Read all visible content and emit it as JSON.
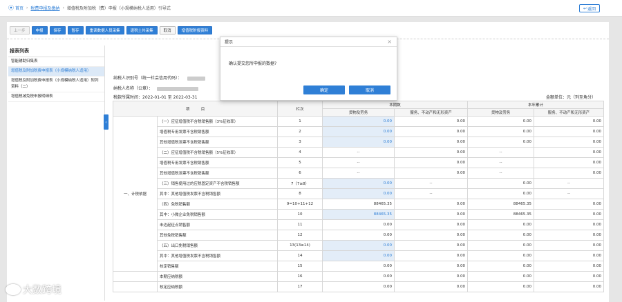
{
  "breadcrumb": {
    "home": "首页",
    "section": "税费申报及缴纳",
    "current": "增值税及附加税（费）申报（小规模纳税人适用）引导式"
  },
  "back_label": "返回",
  "toolbar": [
    {
      "label": "上一步",
      "state": "disabled"
    },
    {
      "label": "申报",
      "state": "primary"
    },
    {
      "label": "保存",
      "state": "primary"
    },
    {
      "label": "暂存",
      "state": "primary"
    },
    {
      "label": "重读数据人员采集",
      "state": "primary"
    },
    {
      "label": "退税土共采集",
      "state": "primary"
    },
    {
      "label": "取消",
      "state": "plain"
    },
    {
      "label": "增值税附报资料",
      "state": "primary"
    }
  ],
  "sidebar": {
    "title": "报表列表",
    "items": [
      {
        "label": "智能辅助归集表"
      },
      {
        "label": "增值税及附加税费申报表（小规模纳税人适用）"
      },
      {
        "label": "增值税及附加税费申报表（小规模纳税人适用）附列资料（二）"
      },
      {
        "label": "增值税减免税申报明细表"
      }
    ]
  },
  "form": {
    "taxpayer_id_label": "纳税人识别号（统一社会信用代码）：",
    "taxpayer_name_label": "纳税人名称（公章）：",
    "period_label": "税款所属时间：2022-01-01 至 2022-03-31",
    "unit_label": "金额单位：元（列至角分）"
  },
  "table": {
    "headers": {
      "item": "项　　　目",
      "col": "栏次",
      "current": "本期数",
      "ytd": "本年累计",
      "goods": "货物及劳务",
      "services": "服务、不动产和无形资产"
    },
    "category": "一、计税依据",
    "rows": [
      {
        "name": "（一）应征增值税不含税销售额（3%征收率）",
        "col": "1",
        "v1": "0.00",
        "v2": "0.00",
        "v3": "0.00",
        "v4": "0.00",
        "b1": true
      },
      {
        "name": "增值税专用发票不含税销售额",
        "col": "2",
        "v1": "0.00",
        "v2": "0.00",
        "v3": "0.00",
        "v4": "0.00",
        "b1": true
      },
      {
        "name": "其他增值税发票不含税销售额",
        "col": "3",
        "v1": "0.00",
        "v2": "0.00",
        "v3": "0.00",
        "v4": "0.00",
        "b1": true
      },
      {
        "name": "（二）应征增值税不含税销售额（5%征收率）",
        "col": "4",
        "v1": "--",
        "v2": "0.00",
        "v3": "--",
        "v4": "0.00"
      },
      {
        "name": "增值税专用发票不含税销售额",
        "col": "5",
        "v1": "--",
        "v2": "0.00",
        "v3": "--",
        "v4": "0.00"
      },
      {
        "name": "其他增值税发票不含税销售额",
        "col": "6",
        "v1": "--",
        "v2": "0.00",
        "v3": "--",
        "v4": "0.00"
      },
      {
        "name": "（三）销售使用过的应税固定资产不含税销售额",
        "col": "7（7≥8）",
        "v1": "0.00",
        "v2": "--",
        "v3": "0.00",
        "v4": "--",
        "b1": true
      },
      {
        "name": "其中：其他增值税发票不含税销售额",
        "col": "8",
        "v1": "0.00",
        "v2": "--",
        "v3": "0.00",
        "v4": "--",
        "b1": true
      },
      {
        "name": "（四）免税销售额",
        "col": "9=10+11+12",
        "v1": "88465.35",
        "v2": "0.00",
        "v3": "88465.35",
        "v4": "0.00"
      },
      {
        "name": "其中：小微企业免税销售额",
        "col": "10",
        "v1": "88465.35",
        "v2": "0.00",
        "v3": "88465.35",
        "v4": "0.00",
        "b1": true
      },
      {
        "name": "未达起征点销售额",
        "col": "11",
        "v1": "0.00",
        "v2": "0.00",
        "v3": "0.00",
        "v4": "0.00"
      },
      {
        "name": "其他免税销售额",
        "col": "12",
        "v1": "0.00",
        "v2": "0.00",
        "v3": "0.00",
        "v4": "0.00"
      },
      {
        "name": "（五）出口免税销售额",
        "col": "13(13≥14)",
        "v1": "0.00",
        "v2": "0.00",
        "v3": "0.00",
        "v4": "0.00",
        "b1": true
      },
      {
        "name": "其中：其他增值税发票不含税销售额",
        "col": "14",
        "v1": "0.00",
        "v2": "0.00",
        "v3": "0.00",
        "v4": "0.00",
        "b1": true
      },
      {
        "name": "核定销售额",
        "col": "15",
        "v1": "0.00",
        "v2": "0.00",
        "v3": "0.00",
        "v4": "0.00"
      },
      {
        "name": "本期应纳税额",
        "col": "16",
        "v1": "0.00",
        "v2": "0.00",
        "v3": "0.00",
        "v4": "0.00"
      },
      {
        "name": "核定应纳税额",
        "col": "17",
        "v1": "0.00",
        "v2": "0.00",
        "v3": "0.00",
        "v4": "0.00"
      }
    ]
  },
  "modal": {
    "title": "提示",
    "message": "确认提交您所申报的数据?",
    "confirm": "确定",
    "cancel": "取消"
  },
  "watermark": "大数跨境",
  "colors": {
    "accent": "#2f7fd6",
    "highlight_cell": "#e3edf8"
  }
}
